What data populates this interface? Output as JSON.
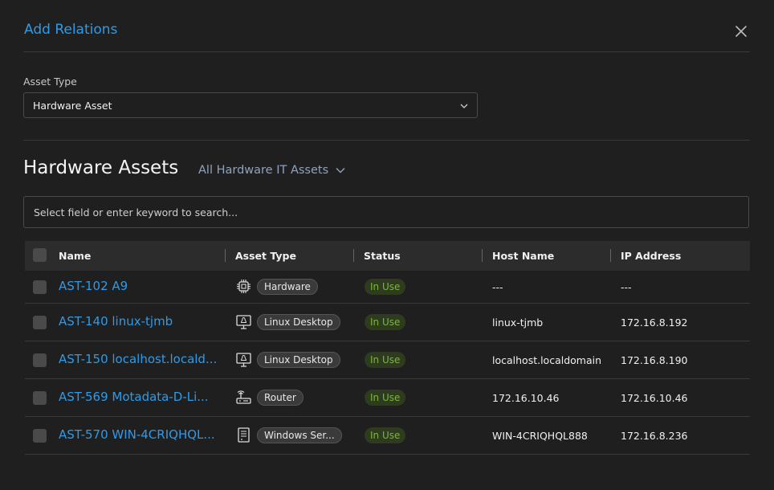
{
  "modal": {
    "title": "Add Relations"
  },
  "asset_type": {
    "label": "Asset Type",
    "value": "Hardware Asset"
  },
  "section": {
    "title": "Hardware Assets",
    "filter_label": "All Hardware IT Assets"
  },
  "search": {
    "placeholder": "Select field or enter keyword to search..."
  },
  "table": {
    "headers": {
      "name": "Name",
      "asset_type": "Asset Type",
      "status": "Status",
      "host_name": "Host Name",
      "ip_address": "IP Address"
    },
    "rows": [
      {
        "name": "AST-102 A9",
        "asset_type": "Hardware",
        "icon": "chip-icon",
        "status": "In Use",
        "host_name": "---",
        "ip_address": "---"
      },
      {
        "name": "AST-140 linux-tjmb",
        "asset_type": "Linux Desktop",
        "icon": "linux-desktop-icon",
        "status": "In Use",
        "host_name": "linux-tjmb",
        "ip_address": "172.16.8.192"
      },
      {
        "name": "AST-150 localhost.locald...",
        "asset_type": "Linux Desktop",
        "icon": "linux-desktop-icon",
        "status": "In Use",
        "host_name": "localhost.localdomain",
        "ip_address": "172.16.8.190"
      },
      {
        "name": "AST-569 Motadata-D-Li...",
        "asset_type": "Router",
        "icon": "router-icon",
        "status": "In Use",
        "host_name": "172.16.10.46",
        "ip_address": "172.16.10.46"
      },
      {
        "name": "AST-570 WIN-4CRIQHQL...",
        "asset_type": "Windows Ser...",
        "icon": "server-icon",
        "status": "In Use",
        "host_name": "WIN-4CRIQHQL888",
        "ip_address": "172.16.8.236"
      }
    ]
  }
}
